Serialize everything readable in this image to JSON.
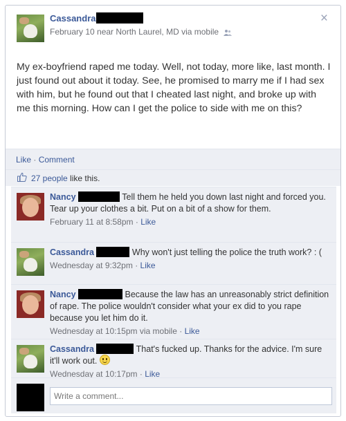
{
  "post": {
    "author": "Cassandra",
    "meta": "February 10 near North Laurel, MD via mobile",
    "close_glyph": "×",
    "status": "My ex-boyfriend raped me today. Well, not today, more like, last month. I just found out about it today. See, he promised to marry me if I had sex with him, but he found out that I cheated last night, and broke up with me this morning. How can I get the police to side with me on this?"
  },
  "actions": {
    "like": "Like",
    "separator": "·",
    "comment": "Comment"
  },
  "likes": {
    "count_text": "27 people",
    "suffix": " like this."
  },
  "comments": [
    {
      "name": "Nancy",
      "text": "Tell them he held you down last night and forced you. Tear up your clothes a bit. Put on a bit of a show for them.",
      "time": "February 11 at 8:58pm",
      "sep": "·",
      "like": "Like"
    },
    {
      "name": "Cassandra",
      "text": "Why won't just telling the police the truth work? : (",
      "time": "Wednesday at 9:32pm",
      "sep": "·",
      "like": "Like"
    },
    {
      "name": "Nancy",
      "text": "Because the law has an unreasonably strict definition of rape. The police wouldn't consider what your ex did to you rape because you let him do it.",
      "time": "Wednesday at 10:15pm via mobile",
      "sep": "·",
      "like": "Like"
    },
    {
      "name": "Cassandra",
      "text": "That's fucked up. Thanks for the advice. I'm sure it'll work out.",
      "time": "Wednesday at 10:17pm",
      "sep": "·",
      "like": "Like"
    }
  ],
  "compose": {
    "placeholder": "Write a comment..."
  },
  "colors": {
    "link": "#3b5998",
    "panel": "#edeff4",
    "meta": "#6d6f75",
    "redaction": "#000000"
  },
  "icons": {
    "close": "close-icon",
    "friends": "friends-icon",
    "like": "thumbs-up-icon",
    "smiley": "smiley-emoticon-icon"
  }
}
